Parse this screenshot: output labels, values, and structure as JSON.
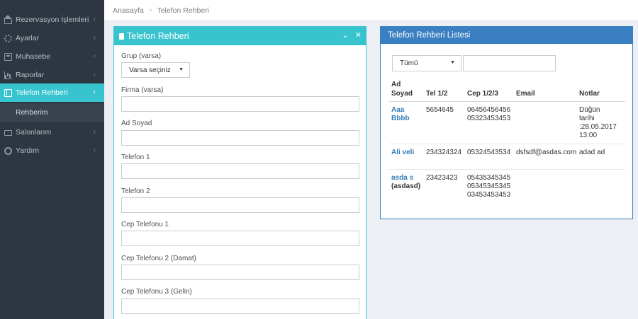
{
  "sidebar": {
    "items": [
      {
        "label": "Rezervasyon İşlemleri",
        "icon": "home-icon"
      },
      {
        "label": "Ayarlar",
        "icon": "gear-icon"
      },
      {
        "label": "Muhasebe",
        "icon": "calculator-icon"
      },
      {
        "label": "Raporlar",
        "icon": "bar-chart-icon"
      },
      {
        "label": "Telefon Rehberi",
        "icon": "book-icon"
      },
      {
        "label": "Salonlarım",
        "icon": "folder-icon"
      },
      {
        "label": "Yardım",
        "icon": "life-ring-icon"
      }
    ],
    "subitem": "Rehberim",
    "chevron": "‹"
  },
  "breadcrumb": {
    "home": "Anasayfa",
    "current": "Telefon Rehberi"
  },
  "form_panel": {
    "title": "Telefon Rehberi",
    "collapse_glyph": "⌄",
    "close_glyph": "✕",
    "group_label": "Grup (varsa)",
    "group_value": "Varsa seçiniz",
    "labels": {
      "firma": "Firma (varsa)",
      "ad_soyad": "Ad Soyad",
      "telefon1": "Telefon 1",
      "telefon2": "Telefon 2",
      "cep1": "Cep Telefonu 1",
      "cep2": "Cep Telefonu 2 (Damat)",
      "cep3": "Cep Telefonu 3 (Gelin)"
    }
  },
  "list_panel": {
    "title": "Telefon Rehberi Listesi",
    "filter_value": "Tümü",
    "columns": {
      "name_line1": "Ad",
      "name_line2": "Soyad",
      "tel": "Tel 1/2",
      "cep": "Cep 1/2/3",
      "email": "Email",
      "notes": "Notlar"
    },
    "rows": [
      {
        "name1": "Aaa",
        "name2": "Bbbb",
        "tel": "5654645",
        "cep": [
          "06456456456",
          "05323453453"
        ],
        "email": "",
        "notes": [
          "Düğün",
          "tarihi",
          ":28.05.2017",
          "13:00"
        ]
      },
      {
        "name1": "Ali veli",
        "tel": "234324324",
        "cep": [
          "05324543534"
        ],
        "email": "dsfsdf@asdas.com",
        "notes": [
          "adad ad"
        ]
      },
      {
        "name1": "asda s",
        "name2": "(asdasd)",
        "tel": "23423423",
        "cep": [
          "05435345345",
          "05345345345",
          "03453453453"
        ],
        "email": "",
        "notes": []
      }
    ]
  },
  "colors": {
    "sidebar_bg": "#2e3741",
    "accent_cyan": "#38c4cf",
    "accent_blue": "#3a7fc1",
    "link_blue": "#337ab7"
  }
}
